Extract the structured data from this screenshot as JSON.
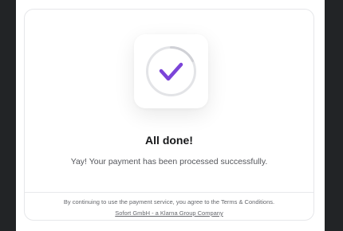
{
  "colors": {
    "accent": "#7b44d8",
    "window_edge": "#222426",
    "card_border": "#e6e7ea",
    "ring": "#e3e4e7"
  },
  "success": {
    "icon": "checkmark-icon",
    "title": "All done!",
    "message": "Yay! Your payment has been processed successfully."
  },
  "footer": {
    "terms_text": "By continuing to use the payment service, you agree to the Terms & Conditions.",
    "company_link": "Sofort GmbH - a Klarna Group Company"
  }
}
